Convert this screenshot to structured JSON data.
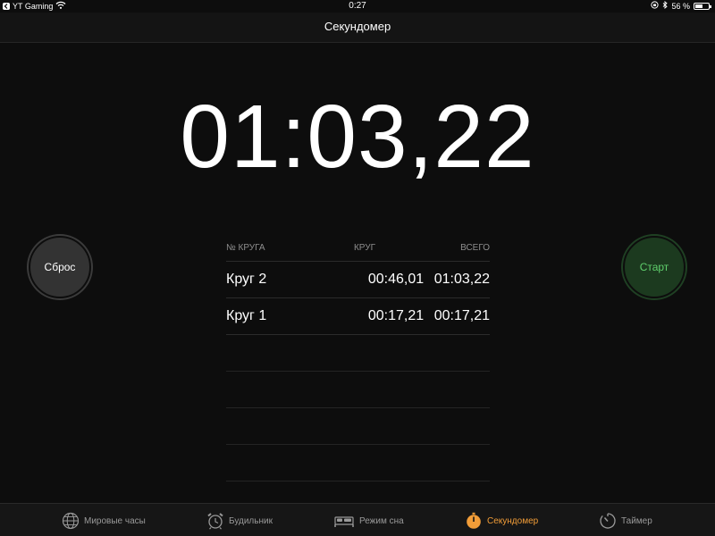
{
  "status": {
    "carrier": "YT Gaming",
    "time": "0:27",
    "battery": "56 %",
    "battery_level": 0.56
  },
  "header": {
    "title": "Секундомер"
  },
  "stopwatch": {
    "time": "01:03,22"
  },
  "buttons": {
    "reset": "Сброс",
    "start": "Старт"
  },
  "laps": {
    "headers": [
      "№ КРУГА",
      "КРУГ",
      "ВСЕГО"
    ],
    "rows": [
      {
        "name": "Круг 2",
        "lap": "00:46,01",
        "total": "01:03,22"
      },
      {
        "name": "Круг 1",
        "lap": "00:17,21",
        "total": "00:17,21"
      }
    ]
  },
  "tabs": [
    {
      "label": "Мировые часы",
      "icon": "globe-icon"
    },
    {
      "label": "Будильник",
      "icon": "alarm-clock-icon"
    },
    {
      "label": "Режим сна",
      "icon": "bed-icon"
    },
    {
      "label": "Секундомер",
      "icon": "stopwatch-icon",
      "active": true
    },
    {
      "label": "Таймер",
      "icon": "timer-icon"
    }
  ],
  "colors": {
    "accent": "#f29d38",
    "start_green": "#5fcf6c"
  }
}
